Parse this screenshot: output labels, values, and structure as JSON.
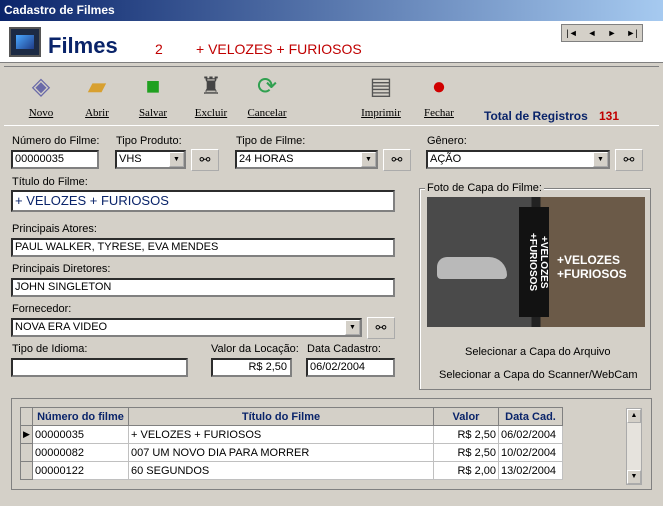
{
  "window": {
    "title": "Cadastro de Filmes"
  },
  "header": {
    "app_name": "Filmes",
    "record_number": "2",
    "record_title": "+ VELOZES + FURIOSOS",
    "nav": [
      "|◄",
      "◄",
      "►",
      "►|"
    ]
  },
  "toolbar": {
    "novo": "Novo",
    "abrir": "Abrir",
    "salvar": "Salvar",
    "excluir": "Excluir",
    "cancelar": "Cancelar",
    "imprimir": "Imprimir",
    "fechar": "Fechar",
    "total_label": "Total de Registros",
    "total_value": "131"
  },
  "form": {
    "numero_label": "Número do Filme:",
    "numero": "00000035",
    "tipo_produto_label": "Tipo Produto:",
    "tipo_produto": "VHS",
    "tipo_filme_label": "Tipo de Filme:",
    "tipo_filme": "24 HORAS",
    "genero_label": "Gênero:",
    "genero": "AÇÃO",
    "titulo_label": "Título do Filme:",
    "titulo": "+ VELOZES + FURIOSOS",
    "atores_label": "Principais Atores:",
    "atores": "PAUL WALKER, TYRESE, EVA MENDES",
    "diretores_label": "Principais Diretores:",
    "diretores": "JOHN SINGLETON",
    "fornecedor_label": "Fornecedor:",
    "fornecedor": "NOVA ERA VIDEO",
    "idioma_label": "Tipo de Idioma:",
    "idioma": "",
    "valor_label": "Valor da Locação:",
    "valor": "R$ 2,50",
    "data_label": "Data Cadastro:",
    "data": "06/02/2004"
  },
  "photo": {
    "group_label": "Foto de Capa do Filme:",
    "cover_text": "+VELOZES +FURIOSOS",
    "select_file": "Selecionar a Capa do Arquivo",
    "select_scanner": "Selecionar a Capa do Scanner/WebCam"
  },
  "grid": {
    "headers": [
      "Número do filme",
      "Título do Filme",
      "Valor",
      "Data Cad."
    ],
    "rows": [
      [
        "00000035",
        "+ VELOZES + FURIOSOS",
        "R$ 2,50",
        "06/02/2004"
      ],
      [
        "00000082",
        "007 UM NOVO DIA PARA MORRER",
        "R$ 2,50",
        "10/02/2004"
      ],
      [
        "00000122",
        "60 SEGUNDOS",
        "R$ 2,00",
        "13/02/2004"
      ]
    ]
  }
}
